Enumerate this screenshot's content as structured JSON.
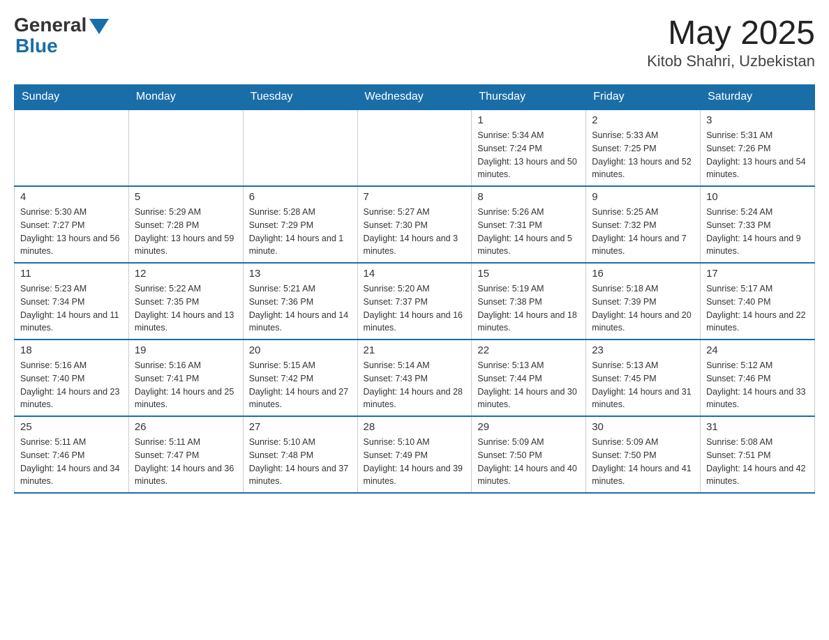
{
  "header": {
    "logo_general": "General",
    "logo_blue": "Blue",
    "month": "May 2025",
    "location": "Kitob Shahri, Uzbekistan"
  },
  "days_of_week": [
    "Sunday",
    "Monday",
    "Tuesday",
    "Wednesday",
    "Thursday",
    "Friday",
    "Saturday"
  ],
  "weeks": [
    [
      {
        "day": "",
        "info": ""
      },
      {
        "day": "",
        "info": ""
      },
      {
        "day": "",
        "info": ""
      },
      {
        "day": "",
        "info": ""
      },
      {
        "day": "1",
        "info": "Sunrise: 5:34 AM\nSunset: 7:24 PM\nDaylight: 13 hours and 50 minutes."
      },
      {
        "day": "2",
        "info": "Sunrise: 5:33 AM\nSunset: 7:25 PM\nDaylight: 13 hours and 52 minutes."
      },
      {
        "day": "3",
        "info": "Sunrise: 5:31 AM\nSunset: 7:26 PM\nDaylight: 13 hours and 54 minutes."
      }
    ],
    [
      {
        "day": "4",
        "info": "Sunrise: 5:30 AM\nSunset: 7:27 PM\nDaylight: 13 hours and 56 minutes."
      },
      {
        "day": "5",
        "info": "Sunrise: 5:29 AM\nSunset: 7:28 PM\nDaylight: 13 hours and 59 minutes."
      },
      {
        "day": "6",
        "info": "Sunrise: 5:28 AM\nSunset: 7:29 PM\nDaylight: 14 hours and 1 minute."
      },
      {
        "day": "7",
        "info": "Sunrise: 5:27 AM\nSunset: 7:30 PM\nDaylight: 14 hours and 3 minutes."
      },
      {
        "day": "8",
        "info": "Sunrise: 5:26 AM\nSunset: 7:31 PM\nDaylight: 14 hours and 5 minutes."
      },
      {
        "day": "9",
        "info": "Sunrise: 5:25 AM\nSunset: 7:32 PM\nDaylight: 14 hours and 7 minutes."
      },
      {
        "day": "10",
        "info": "Sunrise: 5:24 AM\nSunset: 7:33 PM\nDaylight: 14 hours and 9 minutes."
      }
    ],
    [
      {
        "day": "11",
        "info": "Sunrise: 5:23 AM\nSunset: 7:34 PM\nDaylight: 14 hours and 11 minutes."
      },
      {
        "day": "12",
        "info": "Sunrise: 5:22 AM\nSunset: 7:35 PM\nDaylight: 14 hours and 13 minutes."
      },
      {
        "day": "13",
        "info": "Sunrise: 5:21 AM\nSunset: 7:36 PM\nDaylight: 14 hours and 14 minutes."
      },
      {
        "day": "14",
        "info": "Sunrise: 5:20 AM\nSunset: 7:37 PM\nDaylight: 14 hours and 16 minutes."
      },
      {
        "day": "15",
        "info": "Sunrise: 5:19 AM\nSunset: 7:38 PM\nDaylight: 14 hours and 18 minutes."
      },
      {
        "day": "16",
        "info": "Sunrise: 5:18 AM\nSunset: 7:39 PM\nDaylight: 14 hours and 20 minutes."
      },
      {
        "day": "17",
        "info": "Sunrise: 5:17 AM\nSunset: 7:40 PM\nDaylight: 14 hours and 22 minutes."
      }
    ],
    [
      {
        "day": "18",
        "info": "Sunrise: 5:16 AM\nSunset: 7:40 PM\nDaylight: 14 hours and 23 minutes."
      },
      {
        "day": "19",
        "info": "Sunrise: 5:16 AM\nSunset: 7:41 PM\nDaylight: 14 hours and 25 minutes."
      },
      {
        "day": "20",
        "info": "Sunrise: 5:15 AM\nSunset: 7:42 PM\nDaylight: 14 hours and 27 minutes."
      },
      {
        "day": "21",
        "info": "Sunrise: 5:14 AM\nSunset: 7:43 PM\nDaylight: 14 hours and 28 minutes."
      },
      {
        "day": "22",
        "info": "Sunrise: 5:13 AM\nSunset: 7:44 PM\nDaylight: 14 hours and 30 minutes."
      },
      {
        "day": "23",
        "info": "Sunrise: 5:13 AM\nSunset: 7:45 PM\nDaylight: 14 hours and 31 minutes."
      },
      {
        "day": "24",
        "info": "Sunrise: 5:12 AM\nSunset: 7:46 PM\nDaylight: 14 hours and 33 minutes."
      }
    ],
    [
      {
        "day": "25",
        "info": "Sunrise: 5:11 AM\nSunset: 7:46 PM\nDaylight: 14 hours and 34 minutes."
      },
      {
        "day": "26",
        "info": "Sunrise: 5:11 AM\nSunset: 7:47 PM\nDaylight: 14 hours and 36 minutes."
      },
      {
        "day": "27",
        "info": "Sunrise: 5:10 AM\nSunset: 7:48 PM\nDaylight: 14 hours and 37 minutes."
      },
      {
        "day": "28",
        "info": "Sunrise: 5:10 AM\nSunset: 7:49 PM\nDaylight: 14 hours and 39 minutes."
      },
      {
        "day": "29",
        "info": "Sunrise: 5:09 AM\nSunset: 7:50 PM\nDaylight: 14 hours and 40 minutes."
      },
      {
        "day": "30",
        "info": "Sunrise: 5:09 AM\nSunset: 7:50 PM\nDaylight: 14 hours and 41 minutes."
      },
      {
        "day": "31",
        "info": "Sunrise: 5:08 AM\nSunset: 7:51 PM\nDaylight: 14 hours and 42 minutes."
      }
    ]
  ]
}
